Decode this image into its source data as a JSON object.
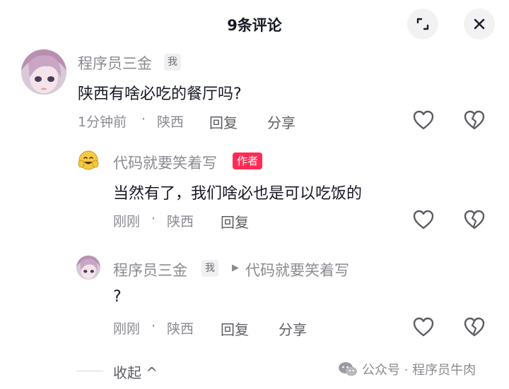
{
  "header": {
    "title": "9条评论"
  },
  "comments": [
    {
      "author": "程序员三金",
      "badge": "我",
      "text": "陕西有啥必吃的餐厅吗?",
      "time": "1分钟前",
      "dot": "·",
      "location": "陕西",
      "reply_label": "回复",
      "share_label": "分享"
    }
  ],
  "replies": [
    {
      "author": "代码就要笑着写",
      "badge": "作者",
      "text": "当然有了，我们啥必也是可以吃饭的",
      "time": "刚刚",
      "dot": "·",
      "location": "陕西",
      "reply_label": "回复"
    },
    {
      "author": "程序员三金",
      "badge": "我",
      "arrow": "▶",
      "reply_to": "代码就要笑着写",
      "text": "?",
      "time": "刚刚",
      "dot": "·",
      "location": "陕西",
      "reply_label": "回复",
      "share_label": "分享"
    }
  ],
  "footer": {
    "collapse_label": "收起",
    "collapse_chevron": "^",
    "watermark": "公众号 · 程序员牛肉"
  },
  "colors": {
    "accent": "#fe2c55",
    "muted": "#8a8b91",
    "text": "#161823"
  }
}
